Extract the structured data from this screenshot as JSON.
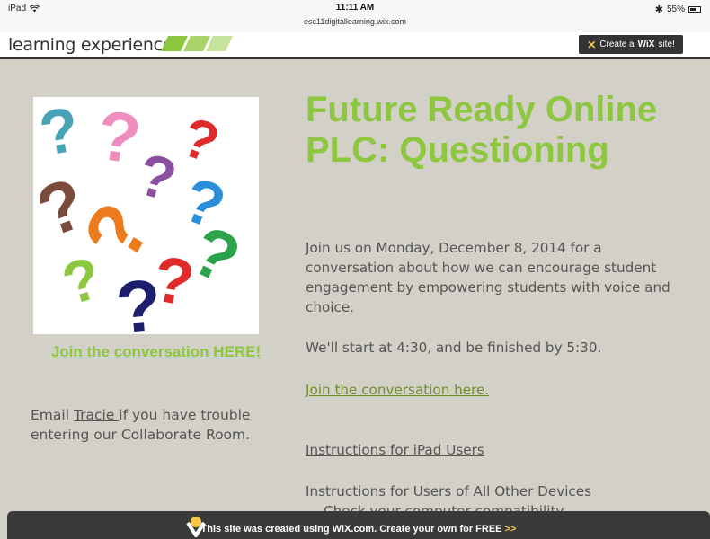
{
  "statusbar": {
    "device": "iPad",
    "time": "11:11 AM",
    "url": "esc11digitallearning.wix.com",
    "battery": "55%"
  },
  "header": {
    "brand": "learning experience",
    "wix_button": {
      "pre": "Create a",
      "brand": "WiX",
      "post": "site!"
    }
  },
  "left": {
    "image_alt": "colorful question marks",
    "join_link": "Join the conversation HERE!",
    "email_pre": "Email ",
    "email_link": "Tracie ",
    "email_post": "if you have trouble entering our Collaborate Room."
  },
  "main": {
    "title": "Future Ready Online PLC: Questioning",
    "description": "Join us on Monday, December 8, 2014 for a conversation about how we can encourage student engagement by empowering students with voice and choice.",
    "start_line": "We'll start at 4:30, and be finished by 5:30.",
    "join_link": "Join the conversation here.",
    "ipad_link": "Instructions for iPad Users",
    "other_devices": "Instructions for Users of All Other Devices",
    "check_compat": "Check your computer compatibility"
  },
  "wixbar": {
    "text_pre": "This site was created using ",
    "text_brand": "WIX.com",
    "text_post": ". Create your own for FREE ",
    "arrows": ">>"
  },
  "colors": {
    "accent": "#8dc63f",
    "background": "#d3d0c8",
    "text": "#555555"
  }
}
